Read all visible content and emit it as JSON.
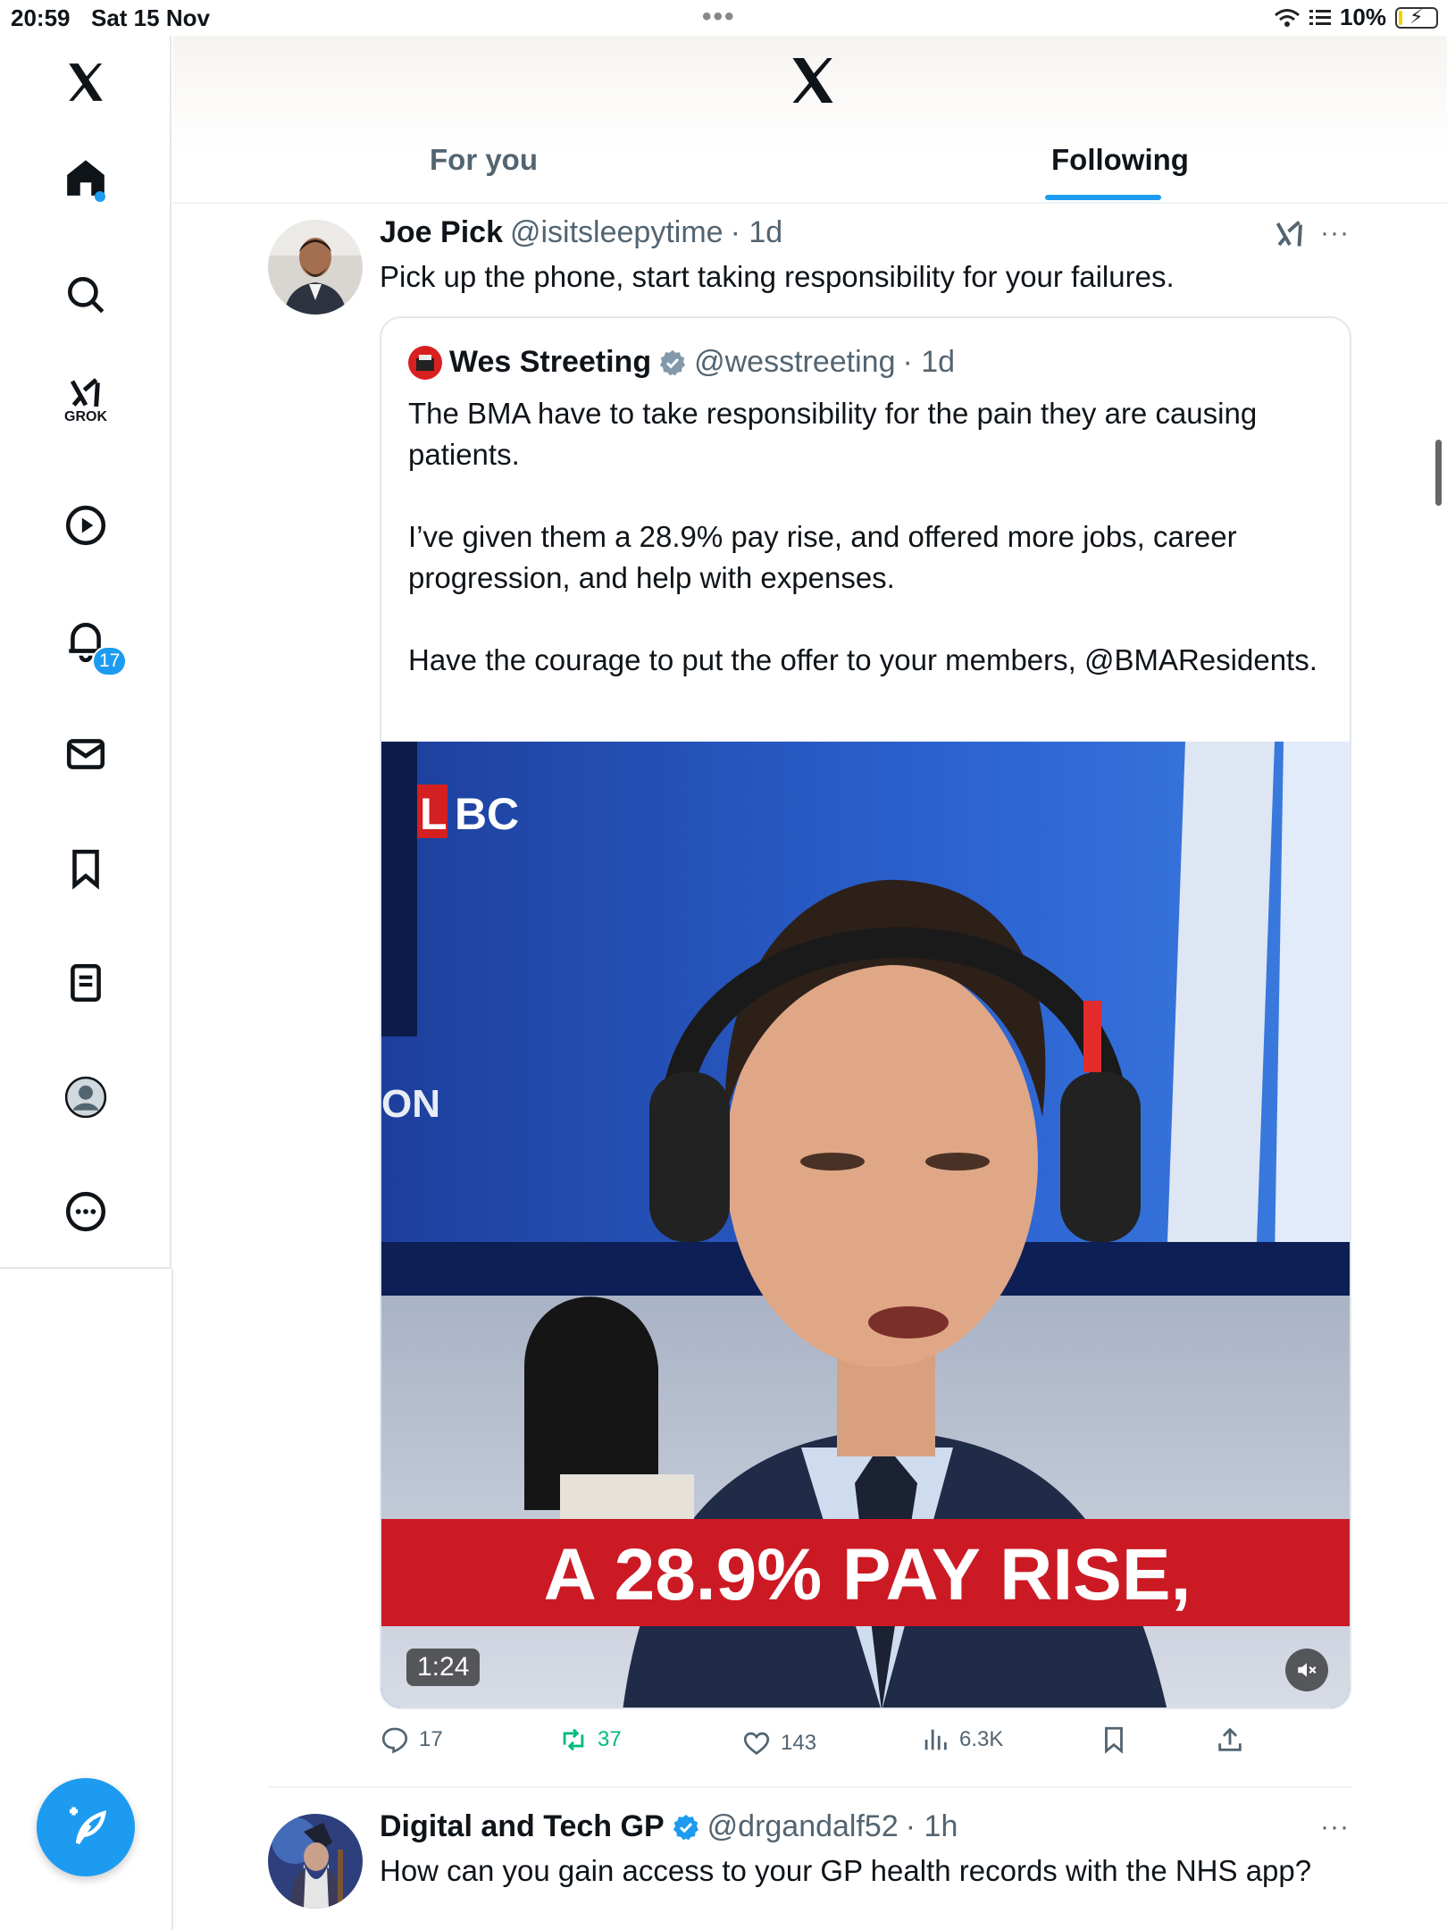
{
  "status_bar": {
    "time": "20:59",
    "date": "Sat 15 Nov",
    "battery": "10%",
    "battery_level": 0.1
  },
  "sidebar": {
    "grok_label": "GROK",
    "notifications_badge": "17",
    "items": [
      "home-icon",
      "search-icon",
      "grok-icon",
      "video-icon",
      "bell-icon",
      "mail-icon",
      "bookmark-icon",
      "list-icon",
      "profile-icon",
      "more-icon"
    ]
  },
  "header": {
    "tabs": [
      {
        "label": "For you",
        "active": false
      },
      {
        "label": "Following",
        "active": true
      }
    ]
  },
  "colors": {
    "accent": "#1d9bf0",
    "repost": "#00ba7c",
    "secondary_text": "#536471"
  },
  "tweets": [
    {
      "name": "Joe Pick",
      "handle": "@isitsleepytime",
      "time": "· 1d",
      "text": "Pick up the phone, start taking responsibility for your failures.",
      "quote": {
        "name": "Wes Streeting",
        "handle": "@wesstreeting",
        "time": "· 1d",
        "paragraphs": [
          "The BMA have to take responsibility for the pain they are causing patients.",
          "I’ve given them a 28.9% pay rise, and offered more jobs, career progression, and help with expenses.",
          "Have the courage to put the offer to your members, @BMAResidents."
        ],
        "media": {
          "duration": "1:24",
          "channel": "LBC",
          "mic_logo": "LBC",
          "side_text": "ON",
          "caption": "A 28.9% PAY RISE,"
        }
      },
      "stats": {
        "replies": "17",
        "reposts": "37",
        "likes": "143",
        "views": "6.3K"
      }
    },
    {
      "name": "Digital and Tech GP",
      "handle": "@drgandalf52",
      "time": "· 1h",
      "text": "How can you gain access to your GP health records with the NHS app?"
    }
  ]
}
